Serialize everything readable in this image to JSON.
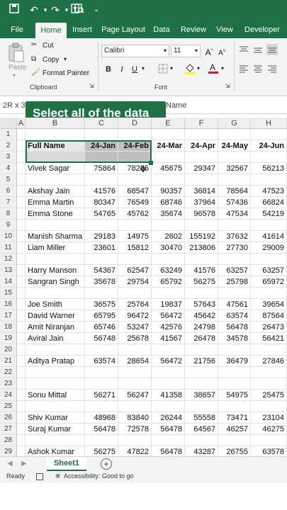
{
  "quick_access": {
    "save_icon": "save-icon",
    "undo_icon": "undo-icon",
    "redo_icon": "redo-icon",
    "filter_icon": "filter-icon",
    "print_preview_icon": "print-preview-icon",
    "more_icon": "customize-icon"
  },
  "tabs": [
    "File",
    "Home",
    "Insert",
    "Page Layout",
    "Data",
    "Review",
    "View",
    "Developer"
  ],
  "ribbon": {
    "paste": "Paste",
    "cut": "Cut",
    "copy": "Copy",
    "format_painter": "Format Painter",
    "clipboard_label": "Clipboard",
    "font_name": "Calibri",
    "font_size": "11",
    "font_label": "Font",
    "bold": "B",
    "italic": "I",
    "underline": "U",
    "grow_font": "A",
    "shrink_font": "A"
  },
  "formula": {
    "name_box": "2R x 3",
    "content": "Name"
  },
  "tooltip": "Select all of the data",
  "columns": [
    "A",
    "B",
    "C",
    "D",
    "E",
    "F",
    "G",
    "H"
  ],
  "header_row": {
    "name": "Full Name",
    "months": [
      "24-Jan",
      "24-Feb",
      "24-Mar",
      "24-Apr",
      "24-May",
      "24-Jun"
    ]
  },
  "rows": [
    {
      "num": "1",
      "name": "",
      "values": []
    },
    {
      "num": "2",
      "name": "Full Name",
      "values": [
        "24-Jan",
        "24-Feb",
        "24-Mar",
        "24-Apr",
        "24-May",
        "24-Jun"
      ]
    },
    {
      "num": "3",
      "name": "",
      "values": []
    },
    {
      "num": "4",
      "name": "Vivek Sagar",
      "values": [
        "75864",
        "78255",
        "45675",
        "29347",
        "32567",
        "56213"
      ]
    },
    {
      "num": "5",
      "name": "",
      "values": []
    },
    {
      "num": "6",
      "name": "Akshay Jain",
      "values": [
        "41576",
        "68547",
        "90357",
        "36814",
        "78564",
        "47523"
      ]
    },
    {
      "num": "7",
      "name": "Emma Martin",
      "values": [
        "80347",
        "76549",
        "68746",
        "37964",
        "57436",
        "66824"
      ]
    },
    {
      "num": "8",
      "name": "Emma Stone",
      "values": [
        "54765",
        "45762",
        "35674",
        "96578",
        "47534",
        "54219"
      ]
    },
    {
      "num": "9",
      "name": "",
      "values": []
    },
    {
      "num": "10",
      "name": "Manish Sharma",
      "values": [
        "29183",
        "14975",
        "2602",
        "155192",
        "37632",
        "41614"
      ]
    },
    {
      "num": "11",
      "name": "Liam Miller",
      "values": [
        "23601",
        "15812",
        "30470",
        "213806",
        "27730",
        "29009"
      ]
    },
    {
      "num": "12",
      "name": "",
      "values": []
    },
    {
      "num": "13",
      "name": "Harry Manson",
      "values": [
        "54367",
        "62547",
        "63249",
        "41576",
        "63257",
        "63257"
      ]
    },
    {
      "num": "14",
      "name": "Sangran Singh",
      "values": [
        "35678",
        "29754",
        "65792",
        "56275",
        "25798",
        "65972"
      ]
    },
    {
      "num": "15",
      "name": "",
      "values": []
    },
    {
      "num": "16",
      "name": "Joe Smith",
      "values": [
        "36575",
        "25764",
        "19837",
        "57643",
        "47561",
        "39654"
      ]
    },
    {
      "num": "17",
      "name": "David Warner",
      "values": [
        "65795",
        "96472",
        "56472",
        "45642",
        "63574",
        "87564"
      ]
    },
    {
      "num": "18",
      "name": "Amit Niranjan",
      "values": [
        "65746",
        "53247",
        "42576",
        "24798",
        "56478",
        "26473"
      ]
    },
    {
      "num": "19",
      "name": "Aviral Jain",
      "values": [
        "56748",
        "25678",
        "41567",
        "26478",
        "34578",
        "56421"
      ]
    },
    {
      "num": "20",
      "name": "",
      "values": []
    },
    {
      "num": "21",
      "name": "Aditya Pratap",
      "values": [
        "63574",
        "28654",
        "56472",
        "21756",
        "36479",
        "27846"
      ]
    },
    {
      "num": "22",
      "name": "",
      "values": []
    },
    {
      "num": "23",
      "name": "",
      "values": []
    },
    {
      "num": "24",
      "name": "Sonu Mittal",
      "values": [
        "56271",
        "56247",
        "41358",
        "38657",
        "54975",
        "25475"
      ]
    },
    {
      "num": "25",
      "name": "",
      "values": []
    },
    {
      "num": "26",
      "name": "Shiv Kumar",
      "values": [
        "48968",
        "83840",
        "26244",
        "55558",
        "73471",
        "23104"
      ]
    },
    {
      "num": "27",
      "name": "Suraj Kumar",
      "values": [
        "56478",
        "72578",
        "56478",
        "64567",
        "46257",
        "46275"
      ]
    },
    {
      "num": "28",
      "name": "",
      "values": []
    },
    {
      "num": "29",
      "name": "Ashok Kumar",
      "values": [
        "56275",
        "47822",
        "56478",
        "43287",
        "26755",
        "63578"
      ]
    }
  ],
  "sheet_tab": "Sheet1",
  "status": {
    "ready": "Ready",
    "accessibility": "Accessibility: Good to go"
  },
  "colors": {
    "excel_green": "#1e7145",
    "selection_gray": "#bfbfbf"
  }
}
